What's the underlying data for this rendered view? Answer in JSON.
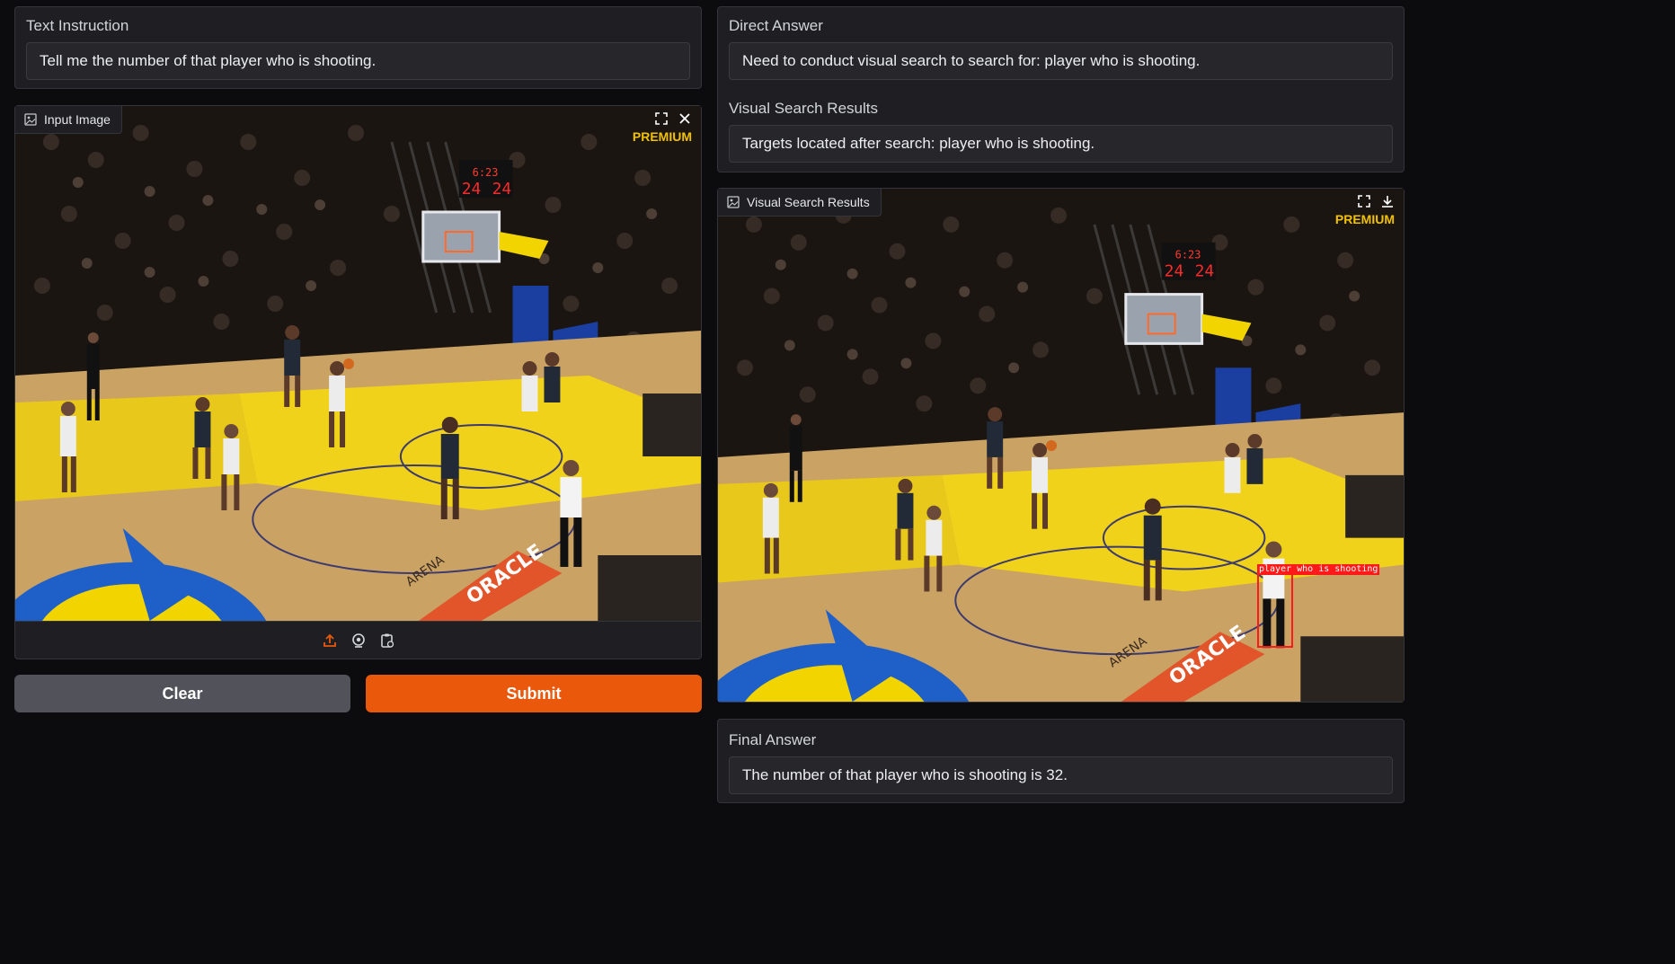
{
  "text_instruction": {
    "label": "Text Instruction",
    "value": "Tell me the number of that player who is shooting."
  },
  "input_image": {
    "label": "Input Image",
    "watermark_badge": "PREMIUM",
    "icons": [
      "image-icon",
      "fullscreen-icon",
      "close-icon",
      "upload-icon",
      "webcam-icon",
      "clipboard-icon"
    ]
  },
  "buttons": {
    "clear_label": "Clear",
    "submit_label": "Submit"
  },
  "direct_answer": {
    "label": "Direct Answer",
    "value": "Need to conduct visual search to search for: player who is shooting."
  },
  "visual_search_text": {
    "label": "Visual Search Results",
    "value": "Targets located after search: player who is shooting."
  },
  "visual_search_image": {
    "label": "Visual Search Results",
    "watermark_badge": "PREMIUM",
    "detection_label": "player who is shooting",
    "icons": [
      "image-icon",
      "fullscreen-icon",
      "download-icon"
    ]
  },
  "final_answer": {
    "label": "Final Answer",
    "value": "The number of that player who is shooting is 32."
  },
  "scene_text": {
    "scoreboard_clock": "6:23",
    "scoreboard_shot": "24",
    "sponsor": "ORACLE",
    "arena_text": "ARENA"
  },
  "colors": {
    "accent": "#ea580c",
    "secondary_button": "#52525b",
    "premium": "#f2c200",
    "detection_box": "#ff1a1a"
  }
}
